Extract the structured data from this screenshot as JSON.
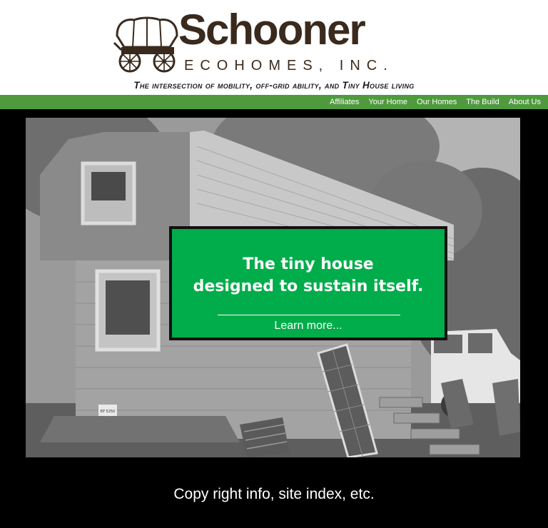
{
  "header": {
    "brand_name": "Schooner",
    "brand_sub": "ECOHOMES, INC.",
    "tagline": "The intersection of mobility, off-grid ability, and Tiny House living"
  },
  "nav": {
    "items": [
      {
        "label": "Affiliates"
      },
      {
        "label": "Your Home"
      },
      {
        "label": "Our Homes"
      },
      {
        "label": "The Build"
      },
      {
        "label": "About Us"
      }
    ],
    "color": "#4e9a3d"
  },
  "hero": {
    "headline_line1": "The tiny house",
    "headline_line2": "designed to sustain itself.",
    "link_label": "Learn more...",
    "callout_color": "#00ad4a",
    "trailer_plate": "EP 5250"
  },
  "footer": {
    "text": "Copy right info, site index, etc."
  },
  "colors": {
    "brand_brown": "#3a2a1d",
    "background": "#000000"
  }
}
